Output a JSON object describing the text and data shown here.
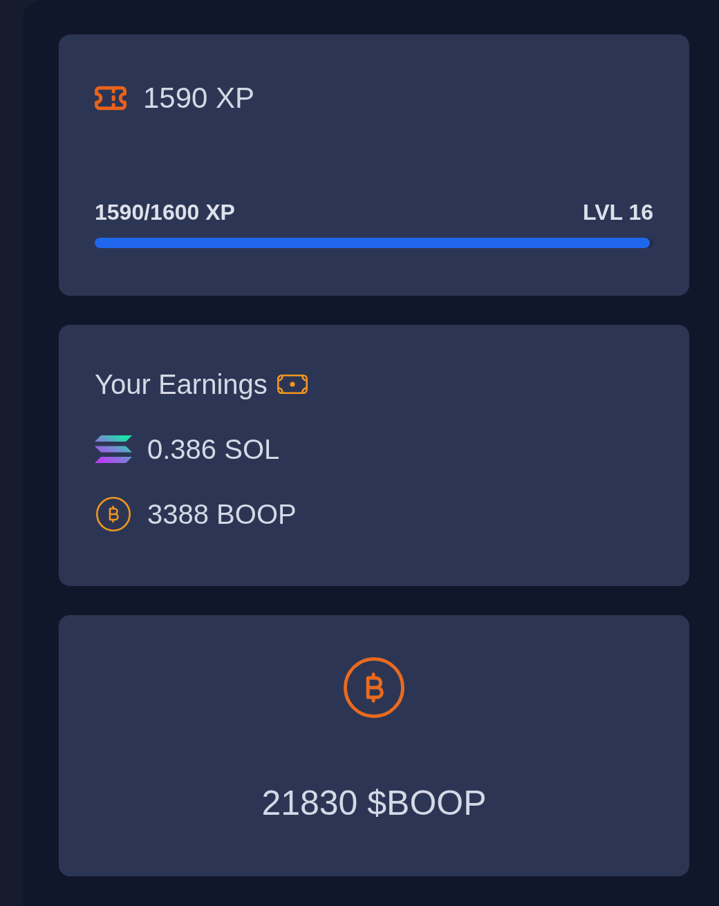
{
  "xp_card": {
    "xp_total": "1590 XP",
    "progress": {
      "label": "1590/1600 XP",
      "level_label": "LVL 16",
      "level": 0.994
    }
  },
  "earnings_card": {
    "title": "Your Earnings",
    "items": [
      {
        "kind": "sol",
        "amount": "0.386 SOL"
      },
      {
        "kind": "boop",
        "amount": "3388 BOOP"
      }
    ]
  },
  "balance_card": {
    "amount": "21830 $BOOP"
  }
}
